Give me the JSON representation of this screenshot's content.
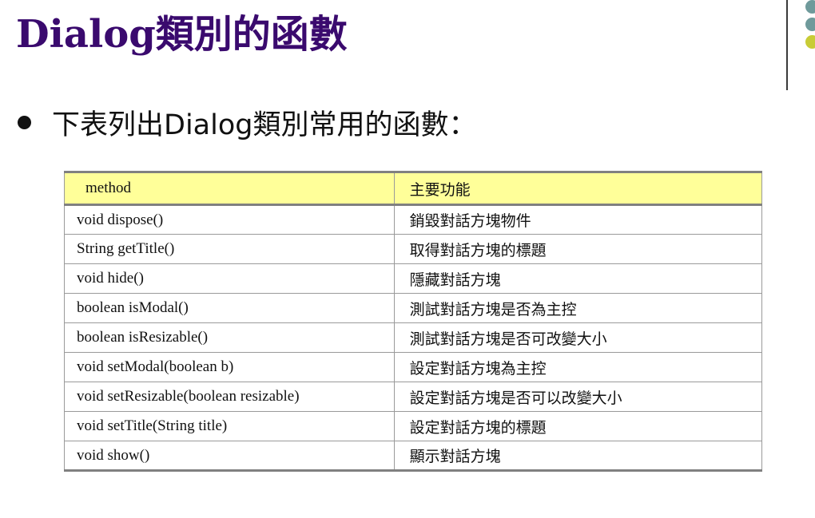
{
  "slide": {
    "title": "Dialog類別的函數",
    "bullet": "下表列出Dialog類別常用的函數："
  },
  "decoration": {
    "dot_colors": [
      "#6f9a9b",
      "#6f9a9b",
      "#c8cc36"
    ]
  },
  "table": {
    "headers": {
      "method": "method",
      "function": "主要功能"
    },
    "rows": [
      {
        "method": "void dispose()",
        "function": "銷毀對話方塊物件"
      },
      {
        "method": "String getTitle()",
        "function": "取得對話方塊的標題"
      },
      {
        "method": "void hide()",
        "function": "隱藏對話方塊"
      },
      {
        "method": "boolean isModal()",
        "function": "測試對話方塊是否為主控"
      },
      {
        "method": "boolean isResizable()",
        "function": "測試對話方塊是否可改變大小"
      },
      {
        "method": "void setModal(boolean b)",
        "function": "設定對話方塊為主控"
      },
      {
        "method": "void setResizable(boolean resizable)",
        "function": "設定對話方塊是否可以改變大小"
      },
      {
        "method": "void setTitle(String title)",
        "function": "設定對話方塊的標題"
      },
      {
        "method": "void show()",
        "function": "顯示對話方塊"
      }
    ]
  }
}
